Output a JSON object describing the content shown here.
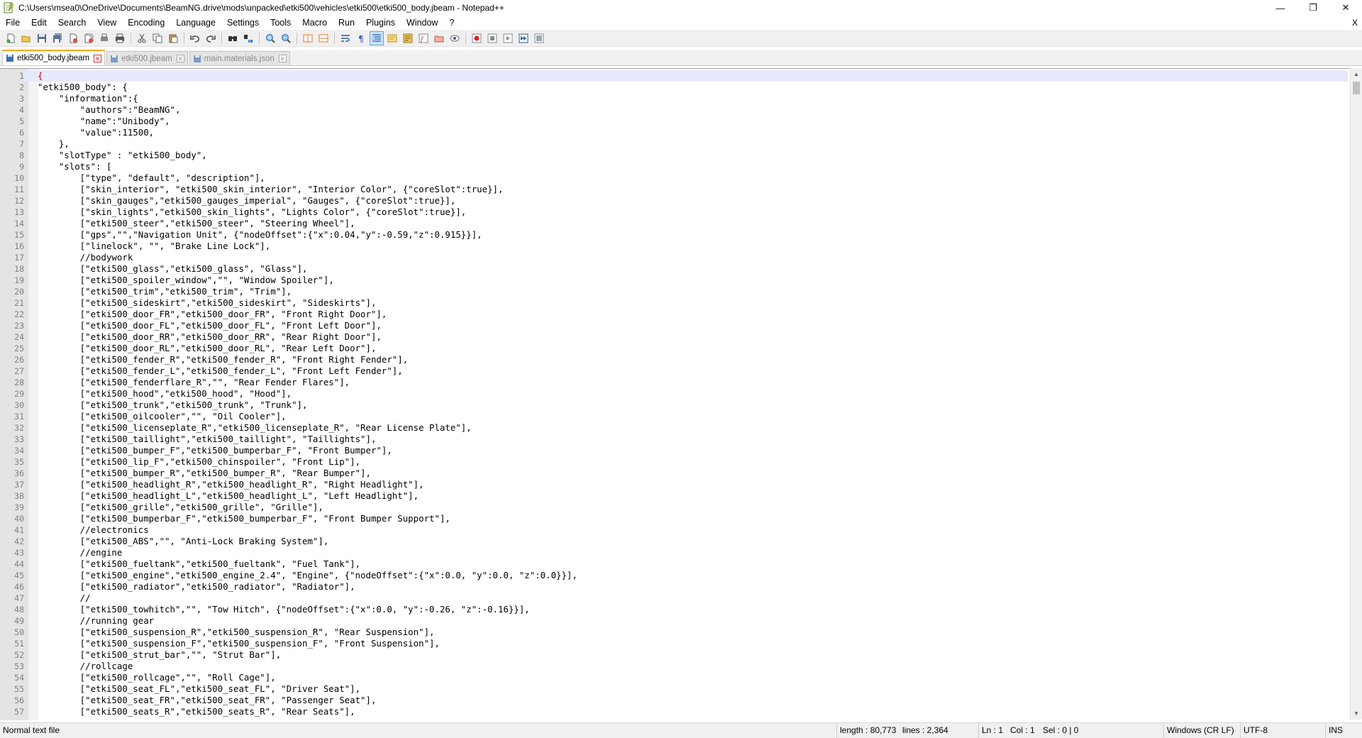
{
  "window": {
    "title": "C:\\Users\\msea0\\OneDrive\\Documents\\BeamNG.drive\\mods\\unpacked\\etki500\\vehicles\\etki500\\etki500_body.jbeam - Notepad++",
    "controls": {
      "minimize": "—",
      "restore": "❐",
      "close": "✕"
    }
  },
  "menu": {
    "items": [
      "File",
      "Edit",
      "Search",
      "View",
      "Encoding",
      "Language",
      "Settings",
      "Tools",
      "Macro",
      "Run",
      "Plugins",
      "Window",
      "?"
    ],
    "close_doc": "X"
  },
  "toolbar": {
    "buttons": [
      "new-file",
      "open-file",
      "save",
      "save-all",
      "close",
      "close-all",
      "print-preview",
      "print",
      "cut",
      "copy",
      "paste",
      "undo",
      "redo",
      "find",
      "replace",
      "zoom-in",
      "zoom-out",
      "sync-vertical",
      "sync-horizontal",
      "word-wrap",
      "show-all-chars",
      "indent-guide",
      "user-defined-language",
      "doc-map",
      "function-list",
      "folder-as-workspace",
      "monitoring",
      "record-macro",
      "stop-macro",
      "play-macro",
      "run-macro-multiple",
      "save-macro"
    ]
  },
  "tabs": [
    {
      "label": "etki500_body.jbeam",
      "active": true
    },
    {
      "label": "etki500.jbeam",
      "active": false
    },
    {
      "label": "main.materials.json",
      "active": false
    }
  ],
  "editor": {
    "lines": [
      "{",
      "\"etki500_body\": {",
      "    \"information\":{",
      "        \"authors\":\"BeamNG\",",
      "        \"name\":\"Unibody\",",
      "        \"value\":11500,",
      "    },",
      "    \"slotType\" : \"etki500_body\",",
      "    \"slots\": [",
      "        [\"type\", \"default\", \"description\"],",
      "        [\"skin_interior\", \"etki500_skin_interior\", \"Interior Color\", {\"coreSlot\":true}],",
      "        [\"skin_gauges\",\"etki500_gauges_imperial\", \"Gauges\", {\"coreSlot\":true}],",
      "        [\"skin_lights\",\"etki500_skin_lights\", \"Lights Color\", {\"coreSlot\":true}],",
      "        [\"etki500_steer\",\"etki500_steer\", \"Steering Wheel\"],",
      "        [\"gps\",\"\",\"Navigation Unit\", {\"nodeOffset\":{\"x\":0.04,\"y\":-0.59,\"z\":0.915}}],",
      "        [\"linelock\", \"\", \"Brake Line Lock\"],",
      "        //bodywork",
      "        [\"etki500_glass\",\"etki500_glass\", \"Glass\"],",
      "        [\"etki500_spoiler_window\",\"\", \"Window Spoiler\"],",
      "        [\"etki500_trim\",\"etki500_trim\", \"Trim\"],",
      "        [\"etki500_sideskirt\",\"etki500_sideskirt\", \"Sideskirts\"],",
      "        [\"etki500_door_FR\",\"etki500_door_FR\", \"Front Right Door\"],",
      "        [\"etki500_door_FL\",\"etki500_door_FL\", \"Front Left Door\"],",
      "        [\"etki500_door_RR\",\"etki500_door_RR\", \"Rear Right Door\"],",
      "        [\"etki500_door_RL\",\"etki500_door_RL\", \"Rear Left Door\"],",
      "        [\"etki500_fender_R\",\"etki500_fender_R\", \"Front Right Fender\"],",
      "        [\"etki500_fender_L\",\"etki500_fender_L\", \"Front Left Fender\"],",
      "        [\"etki500_fenderflare_R\",\"\", \"Rear Fender Flares\"],",
      "        [\"etki500_hood\",\"etki500_hood\", \"Hood\"],",
      "        [\"etki500_trunk\",\"etki500_trunk\", \"Trunk\"],",
      "        [\"etki500_oilcooler\",\"\", \"Oil Cooler\"],",
      "        [\"etki500_licenseplate_R\",\"etki500_licenseplate_R\", \"Rear License Plate\"],",
      "        [\"etki500_taillight\",\"etki500_taillight\", \"Taillights\"],",
      "        [\"etki500_bumper_F\",\"etki500_bumperbar_F\", \"Front Bumper\"],",
      "        [\"etki500_lip_F\",\"etki500_chinspoiler\", \"Front Lip\"],",
      "        [\"etki500_bumper_R\",\"etki500_bumper_R\", \"Rear Bumper\"],",
      "        [\"etki500_headlight_R\",\"etki500_headlight_R\", \"Right Headlight\"],",
      "        [\"etki500_headlight_L\",\"etki500_headlight_L\", \"Left Headlight\"],",
      "        [\"etki500_grille\",\"etki500_grille\", \"Grille\"],",
      "        [\"etki500_bumperbar_F\",\"etki500_bumperbar_F\", \"Front Bumper Support\"],",
      "        //electronics",
      "        [\"etki500_ABS\",\"\", \"Anti-Lock Braking System\"],",
      "        //engine",
      "        [\"etki500_fueltank\",\"etki500_fueltank\", \"Fuel Tank\"],",
      "        [\"etki500_engine\",\"etki500_engine_2.4\", \"Engine\", {\"nodeOffset\":{\"x\":0.0, \"y\":0.0, \"z\":0.0}}],",
      "        [\"etki500_radiator\",\"etki500_radiator\", \"Radiator\"],",
      "        //",
      "        [\"etki500_towhitch\",\"\", \"Tow Hitch\", {\"nodeOffset\":{\"x\":0.0, \"y\":-0.26, \"z\":-0.16}}],",
      "        //running gear",
      "        [\"etki500_suspension_R\",\"etki500_suspension_R\", \"Rear Suspension\"],",
      "        [\"etki500_suspension_F\",\"etki500_suspension_F\", \"Front Suspension\"],",
      "        [\"etki500_strut_bar\",\"\", \"Strut Bar\"],",
      "        //rollcage",
      "        [\"etki500_rollcage\",\"\", \"Roll Cage\"],",
      "        [\"etki500_seat_FL\",\"etki500_seat_FL\", \"Driver Seat\"],",
      "        [\"etki500_seat_FR\",\"etki500_seat_FR\", \"Passenger Seat\"],",
      "        [\"etki500_seats_R\",\"etki500_seats_R\", \"Rear Seats\"],"
    ]
  },
  "status": {
    "file_type": "Normal text file",
    "length": "length : 80,773",
    "lines": "lines : 2,364",
    "ln": "Ln : 1",
    "col": "Col : 1",
    "sel": "Sel : 0 | 0",
    "eol": "Windows (CR LF)",
    "encoding": "UTF-8",
    "mode": "INS"
  }
}
